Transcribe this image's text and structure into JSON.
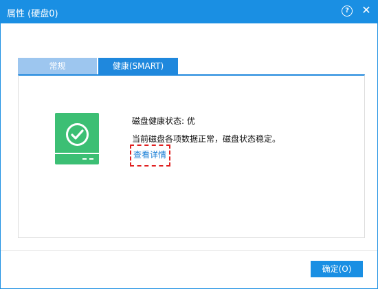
{
  "window": {
    "title": "属性 (硬盘0)",
    "help_glyph": "?",
    "close_glyph": "✕"
  },
  "tabs": [
    {
      "label": "常规"
    },
    {
      "label": "健康(SMART)"
    }
  ],
  "health": {
    "status_line": "磁盘健康状态: 优",
    "description": "当前磁盘各项数据正常，磁盘状态稳定。",
    "details_link": "查看详情"
  },
  "footer": {
    "ok_label": "确定(O)"
  },
  "colors": {
    "accent": "#1a8fe3",
    "tab_inactive": "#9dc6ef",
    "disk_green": "#3cbf74",
    "highlight_red": "#e02020",
    "link_blue": "#1a7fd6"
  },
  "icons": [
    "help-icon",
    "close-icon",
    "disk-health-icon",
    "checkmark-icon"
  ]
}
